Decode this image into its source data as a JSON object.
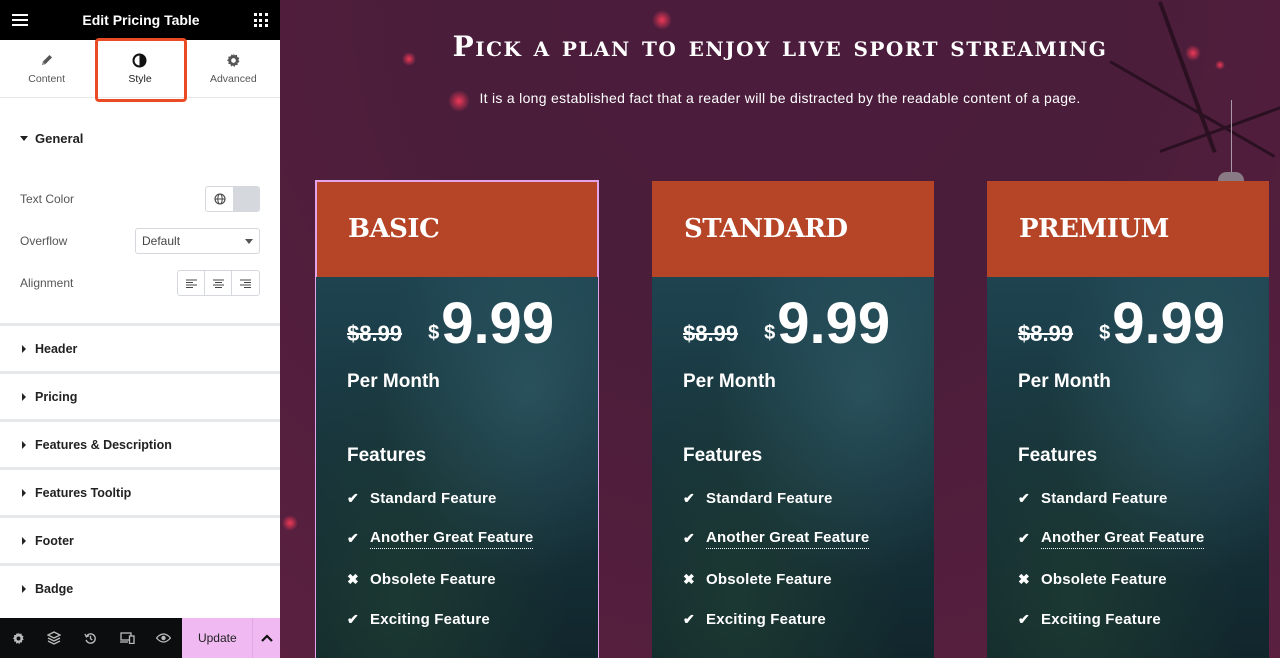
{
  "sidebar": {
    "title": "Edit Pricing Table",
    "tabs": [
      {
        "label": "Content",
        "icon": "pencil-icon",
        "active": false
      },
      {
        "label": "Style",
        "icon": "contrast-icon",
        "active": true
      },
      {
        "label": "Advanced",
        "icon": "gear-icon",
        "active": false
      }
    ],
    "general": {
      "title": "General",
      "text_color_label": "Text Color",
      "overflow_label": "Overflow",
      "overflow_value": "Default",
      "alignment_label": "Alignment"
    },
    "sections": [
      "Header",
      "Pricing",
      "Features & Description",
      "Features Tooltip",
      "Footer",
      "Badge"
    ],
    "bottom": {
      "icons": [
        "settings-icon",
        "layers-icon",
        "history-icon",
        "responsive-icon",
        "preview-eye-icon"
      ],
      "update_label": "Update"
    }
  },
  "canvas": {
    "headline": "Pick a plan to enjoy live sport streaming",
    "subline": "It is a long established fact that a reader will be distracted by the readable content of a page.",
    "colors": {
      "header": "#b64426",
      "background": "#4a1d3a",
      "selected_outline": "#e3a3e8"
    },
    "plans": [
      {
        "name": "BASIC",
        "old_price": "$8.99",
        "currency": "$",
        "price": "9.99",
        "period": "Per Month",
        "features_title": "Features",
        "features": [
          {
            "text": "Standard Feature",
            "icon": "check",
            "tooltip": false
          },
          {
            "text": "Another Great Feature",
            "icon": "check",
            "tooltip": true
          },
          {
            "text": "Obsolete Feature",
            "icon": "cross",
            "tooltip": false
          },
          {
            "text": "Exciting Feature",
            "icon": "check",
            "tooltip": false
          }
        ]
      },
      {
        "name": "STANDARD",
        "old_price": "$8.99",
        "currency": "$",
        "price": "9.99",
        "period": "Per Month",
        "features_title": "Features",
        "features": [
          {
            "text": "Standard Feature",
            "icon": "check",
            "tooltip": false
          },
          {
            "text": "Another Great Feature",
            "icon": "check",
            "tooltip": true
          },
          {
            "text": "Obsolete Feature",
            "icon": "cross",
            "tooltip": false
          },
          {
            "text": "Exciting Feature",
            "icon": "check",
            "tooltip": false
          }
        ]
      },
      {
        "name": "PREMIUM",
        "old_price": "$8.99",
        "currency": "$",
        "price": "9.99",
        "period": "Per Month",
        "features_title": "Features",
        "features": [
          {
            "text": "Standard Feature",
            "icon": "check",
            "tooltip": false
          },
          {
            "text": "Another Great Feature",
            "icon": "check",
            "tooltip": true
          },
          {
            "text": "Obsolete Feature",
            "icon": "cross",
            "tooltip": false
          },
          {
            "text": "Exciting Feature",
            "icon": "check",
            "tooltip": false
          }
        ]
      }
    ]
  }
}
